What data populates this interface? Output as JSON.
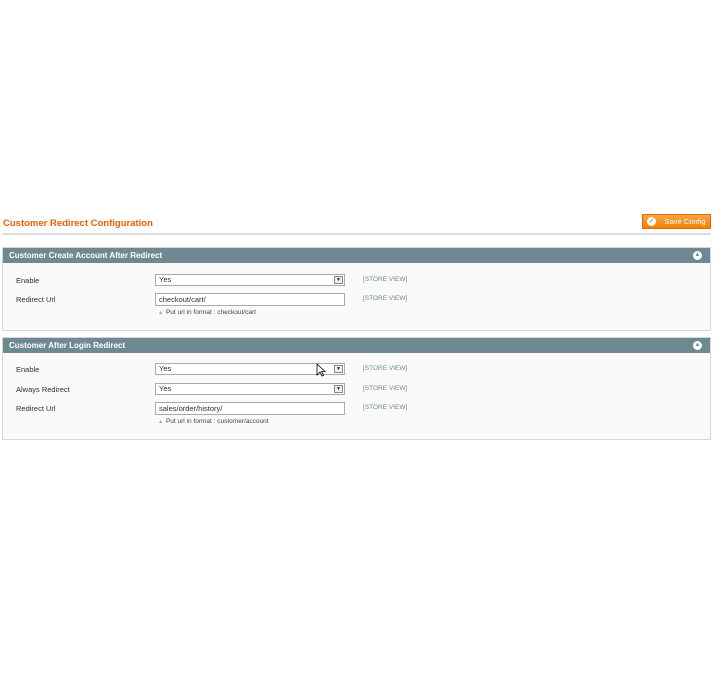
{
  "page": {
    "title": "Customer Redirect Configuration",
    "save_label": "Save Config"
  },
  "sections": [
    {
      "title": "Customer Create Account After Redirect",
      "fields": {
        "enable": {
          "label": "Enable",
          "value": "Yes",
          "scope": "[STORE VIEW]"
        },
        "redirect_url": {
          "label": "Redirect Url",
          "value": "checkout/cart/",
          "scope": "[STORE VIEW]",
          "note": "Put url in format : checkout/cart"
        }
      }
    },
    {
      "title": "Customer After Login Redirect",
      "fields": {
        "enable": {
          "label": "Enable",
          "value": "Yes",
          "scope": "[STORE VIEW]"
        },
        "always_redirect": {
          "label": "Always Redirect",
          "value": "Yes",
          "scope": "[STORE VIEW]"
        },
        "redirect_url": {
          "label": "Redirect Url",
          "value": "sales/order/history/",
          "scope": "[STORE VIEW]",
          "note": "Put url in format : customer/account"
        }
      }
    }
  ],
  "icons": {
    "save": "check-circle-icon",
    "collapse": "chevron-up-icon",
    "dropdown": "triangle-down-icon",
    "note": "triangle-up-icon",
    "cursor": "mouse-pointer-icon"
  },
  "colors": {
    "title": "#eb5e00",
    "save_button": "#f18200",
    "section_header": "#6f8992",
    "scope_text": "#6f8992"
  }
}
